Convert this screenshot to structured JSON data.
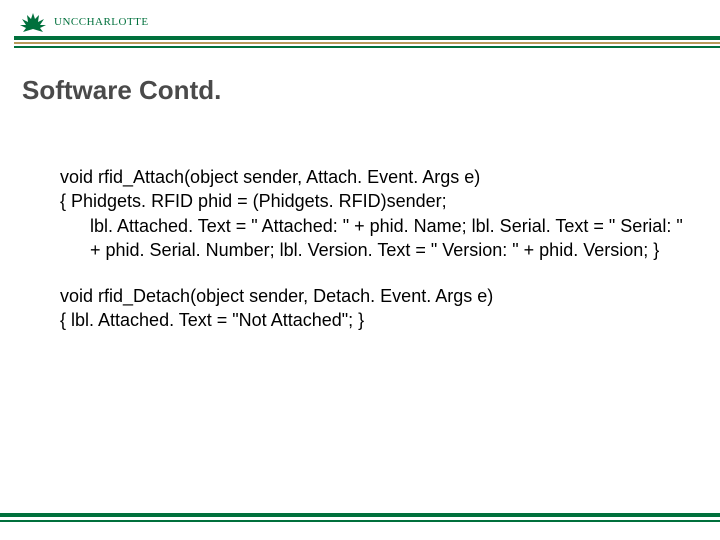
{
  "brand": {
    "wordmark_left": "UNC",
    "wordmark_right": "CHARLOTTE",
    "colors": {
      "green": "#00703c",
      "gold": "#b89a5a",
      "title_gray": "#4a4a4a"
    }
  },
  "title": "Software Contd.",
  "code": {
    "block1": {
      "line1": "void rfid_Attach(object sender, Attach. Event. Args e)",
      "line2_a": " { Phidgets. RFID phid = (Phidgets. RFID)sender;",
      "line2_b": "lbl. Attached. Text = \" Attached: \" + phid. Name; lbl. Serial. Text = \" Serial: \" + phid. Serial. Number; lbl. Version. Text = \" Version: \" + phid. Version; }"
    },
    "block2": {
      "line1": "void rfid_Detach(object sender, Detach. Event. Args e)",
      "line2": "{ lbl. Attached. Text = \"Not Attached\"; }"
    }
  }
}
